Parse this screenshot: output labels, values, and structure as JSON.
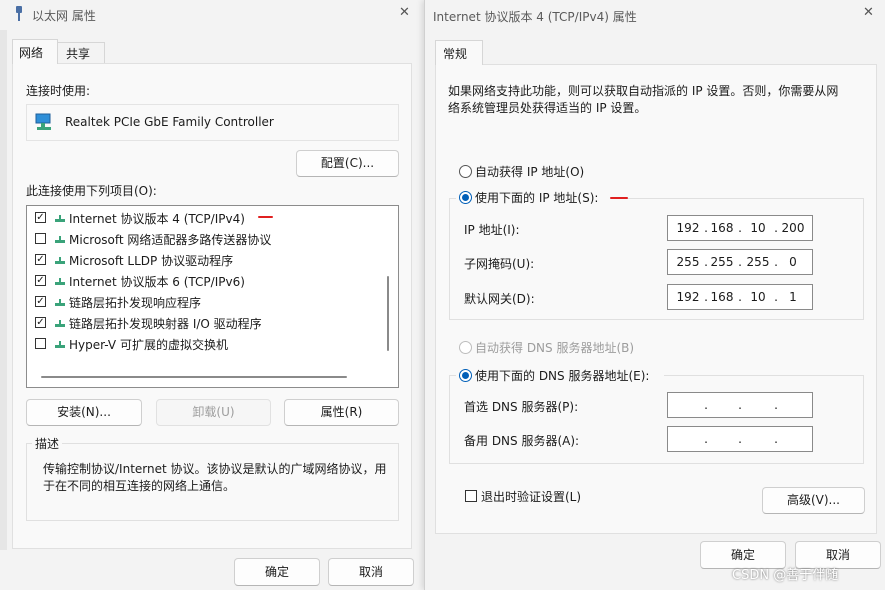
{
  "left_dialog": {
    "title": "以太网 属性",
    "tabs": [
      "网络",
      "共享"
    ],
    "connect_using_label": "连接时使用:",
    "adapter_name": "Realtek PCIe GbE Family Controller",
    "configure_button": "配置(C)...",
    "items_label": "此连接使用下列项目(O):",
    "items": [
      {
        "label": "Internet 协议版本 4 (TCP/IPv4)",
        "checked": true
      },
      {
        "label": "Microsoft 网络适配器多路传送器协议",
        "checked": false
      },
      {
        "label": "Microsoft LLDP 协议驱动程序",
        "checked": true
      },
      {
        "label": "Internet 协议版本 6 (TCP/IPv6)",
        "checked": true
      },
      {
        "label": "链路层拓扑发现响应程序",
        "checked": true
      },
      {
        "label": "链路层拓扑发现映射器 I/O 驱动程序",
        "checked": true
      },
      {
        "label": "Hyper-V 可扩展的虚拟交换机",
        "checked": false
      }
    ],
    "install_button": "安装(N)...",
    "uninstall_button": "卸载(U)",
    "properties_button": "属性(R)",
    "description_label": "描述",
    "description_line1": "传输控制协议/Internet 协议。该协议是默认的广域网络协议，用",
    "description_line2": "于在不同的相互连接的网络上通信。",
    "ok_button": "确定",
    "cancel_button": "取消"
  },
  "right_dialog": {
    "title": "Internet 协议版本 4 (TCP/IPv4) 属性",
    "tab": "常规",
    "intro_line1": "如果网络支持此功能，则可以获取自动指派的 IP 设置。否则，你需要从网",
    "intro_line2": "络系统管理员处获得适当的 IP 设置。",
    "auto_ip_label": "自动获得 IP 地址(O)",
    "manual_ip_label": "使用下面的 IP 地址(S):",
    "ip_label": "IP 地址(I):",
    "ip_value": [
      "192",
      "168",
      "10",
      "200"
    ],
    "subnet_label": "子网掩码(U):",
    "subnet_value": [
      "255",
      "255",
      "255",
      "0"
    ],
    "gateway_label": "默认网关(D):",
    "gateway_value": [
      "192",
      "168",
      "10",
      "1"
    ],
    "auto_dns_label": "自动获得 DNS 服务器地址(B)",
    "manual_dns_label": "使用下面的 DNS 服务器地址(E):",
    "preferred_dns_label": "首选 DNS 服务器(P):",
    "alternate_dns_label": "备用 DNS 服务器(A):",
    "dot": ".",
    "validate_label": "退出时验证设置(L)",
    "advanced_button": "高级(V)...",
    "ok_button": "确定",
    "cancel_button": "取消"
  },
  "close_glyph": "✕",
  "watermark": "CSDN @善于伴随",
  "colors": {
    "accent": "#005fb8",
    "annotation_red": "#e02020",
    "icon_green": "#3aa37a"
  }
}
